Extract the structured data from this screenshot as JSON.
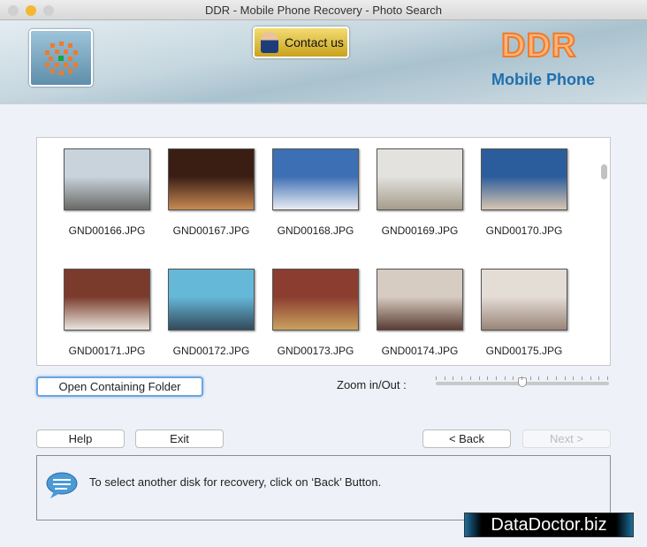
{
  "window": {
    "title": "DDR - Mobile Phone Recovery - Photo Search"
  },
  "header": {
    "contact_label": "Contact us",
    "brand": "DDR",
    "product": "Mobile Phone"
  },
  "photos": [
    {
      "name": "GND00166.JPG",
      "c1": "#c9d3dc",
      "c2": "#6a6a66"
    },
    {
      "name": "GND00167.JPG",
      "c1": "#3a1e14",
      "c2": "#c88a52"
    },
    {
      "name": "GND00168.JPG",
      "c1": "#3d6fb4",
      "c2": "#e9edf2"
    },
    {
      "name": "GND00169.JPG",
      "c1": "#e3e2df",
      "c2": "#a59c8a"
    },
    {
      "name": "GND00170.JPG",
      "c1": "#2b5d9c",
      "c2": "#d8c5b0"
    },
    {
      "name": "GND00171.JPG",
      "c1": "#7b3b2c",
      "c2": "#e8e5dd"
    },
    {
      "name": "GND00172.JPG",
      "c1": "#66b8d9",
      "c2": "#324a5c"
    },
    {
      "name": "GND00173.JPG",
      "c1": "#8b3d2f",
      "c2": "#caa25e"
    },
    {
      "name": "GND00174.JPG",
      "c1": "#d7ccc2",
      "c2": "#5a3d33"
    },
    {
      "name": "GND00175.JPG",
      "c1": "#e4ddd6",
      "c2": "#9a8578"
    }
  ],
  "actions": {
    "open_folder": "Open Containing Folder",
    "zoom_label": "Zoom in/Out :",
    "zoom_value": 50,
    "help": "Help",
    "exit": "Exit",
    "back": "< Back",
    "next": "Next >"
  },
  "status": {
    "message": "To select another disk for recovery, click on ‘Back’ Button."
  },
  "watermark": "DataDoctor.biz"
}
